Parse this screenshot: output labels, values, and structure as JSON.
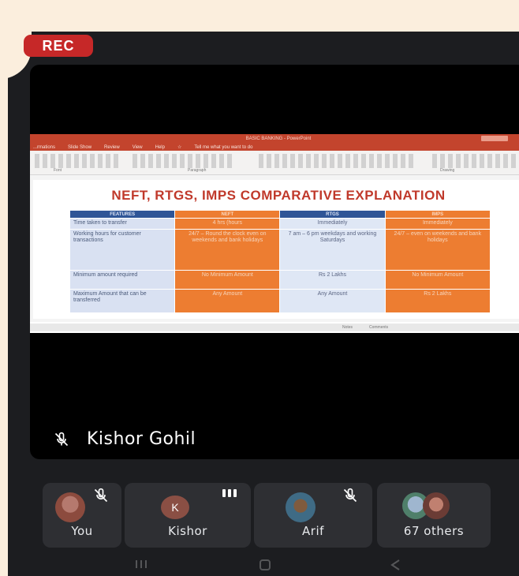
{
  "recording": {
    "label": "REC",
    "color": "#c62828"
  },
  "app_window": {
    "title": "BASIC BANKING - PowerPoint",
    "menu": [
      "...rmations",
      "Slide Show",
      "Review",
      "View",
      "Help",
      "☆",
      "Tell me what you want to do"
    ],
    "group_labels": [
      "Font",
      "Paragraph",
      "Drawing"
    ],
    "status_items": [
      "Notes",
      "Comments"
    ]
  },
  "slide": {
    "heading": "NEFT, RTGS, IMPS COMPARATIVE EXPLANATION",
    "columns": [
      "FEATURES",
      "NEFT",
      "RTGS",
      "IMPS"
    ],
    "rows": [
      {
        "feature": "Time taken to transfer",
        "neft": "4 hrs (hours",
        "rtgs": "Immediately",
        "imps": "Immediately"
      },
      {
        "feature": "Working hours for customer transactions",
        "neft": "24/7 – Round the clock even on weekends and bank holidays",
        "rtgs": "7 am – 6 pm weekdays and working Saturdays",
        "imps": "24/7 – even on weekends and bank holidays"
      },
      {
        "feature": "Minimum amount required",
        "neft": "No Minimum Amount",
        "rtgs": "Rs 2 Lakhs",
        "imps": "No Minimum Amount"
      },
      {
        "feature": "Maximum Amount that can be transferred",
        "neft": "Any Amount",
        "rtgs": "Any Amount",
        "imps": "Rs 2 Lakhs"
      }
    ]
  },
  "speaker": {
    "name": "Kishor Gohil",
    "mic_icon": "mic-off-icon"
  },
  "participants": [
    {
      "label": "You",
      "icon": "mic-off-icon"
    },
    {
      "label": "Kishor",
      "initial": "K",
      "icon": "speaking-dots-icon"
    },
    {
      "label": "Arif",
      "icon": "mic-off-icon"
    },
    {
      "label": "67 others"
    }
  ],
  "nav_icons": [
    "recent-apps-icon",
    "home-icon",
    "back-icon"
  ]
}
